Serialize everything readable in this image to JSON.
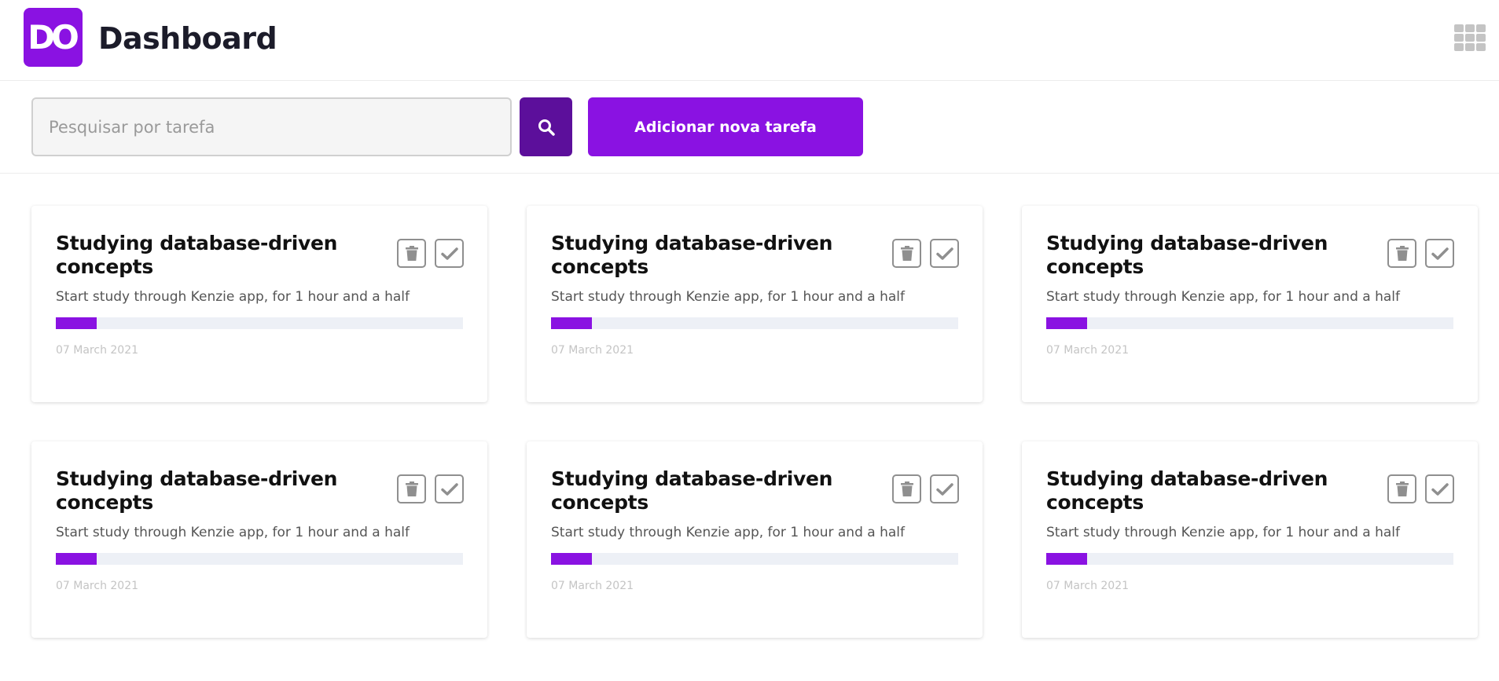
{
  "header": {
    "logo_text": "DO",
    "title": "Dashboard",
    "menu_icon": "grid-icon"
  },
  "toolbar": {
    "search_placeholder": "Pesquisar por tarefa",
    "search_value": "",
    "search_icon": "search-icon",
    "add_label": "Adicionar nova tarefa"
  },
  "colors": {
    "primary": "#8a12e2",
    "primary_dark": "#5c0f9b",
    "progress_track": "#edf0f6"
  },
  "tasks": [
    {
      "title": "Studying database-driven concepts",
      "description": "Start study through Kenzie app, for 1 hour and a half",
      "progress": 0.1,
      "date": "07 March 2021"
    },
    {
      "title": "Studying database-driven concepts",
      "description": "Start study through Kenzie app, for 1 hour and a half",
      "progress": 0.1,
      "date": "07 March 2021"
    },
    {
      "title": "Studying database-driven concepts",
      "description": "Start study through Kenzie app, for 1 hour and a half",
      "progress": 0.1,
      "date": "07 March 2021"
    },
    {
      "title": "Studying database-driven concepts",
      "description": "Start study through Kenzie app, for 1 hour and a half",
      "progress": 0.1,
      "date": "07 March 2021"
    },
    {
      "title": "Studying database-driven concepts",
      "description": "Start study through Kenzie app, for 1 hour and a half",
      "progress": 0.1,
      "date": "07 March 2021"
    },
    {
      "title": "Studying database-driven concepts",
      "description": "Start study through Kenzie app, for 1 hour and a half",
      "progress": 0.1,
      "date": "07 March 2021"
    }
  ]
}
